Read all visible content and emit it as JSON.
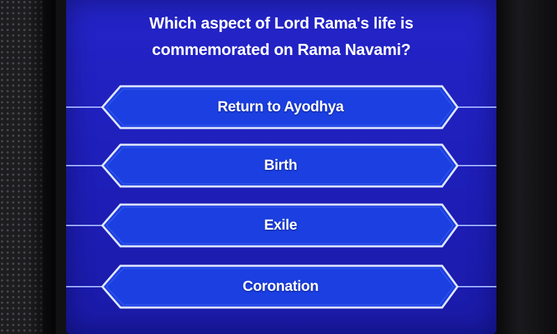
{
  "quiz": {
    "question_line1": "Which aspect of Lord Rama's life is",
    "question_line2": "commemorated on Rama Navami?",
    "answers": [
      {
        "label": "Return to Ayodhya"
      },
      {
        "label": "Birth"
      },
      {
        "label": "Exile"
      },
      {
        "label": "Coronation"
      }
    ]
  },
  "colors": {
    "screen_background": "#2424c9",
    "answer_fill": "#1b3fe0",
    "answer_border": "#dfe6ff",
    "text": "#ffffff"
  }
}
